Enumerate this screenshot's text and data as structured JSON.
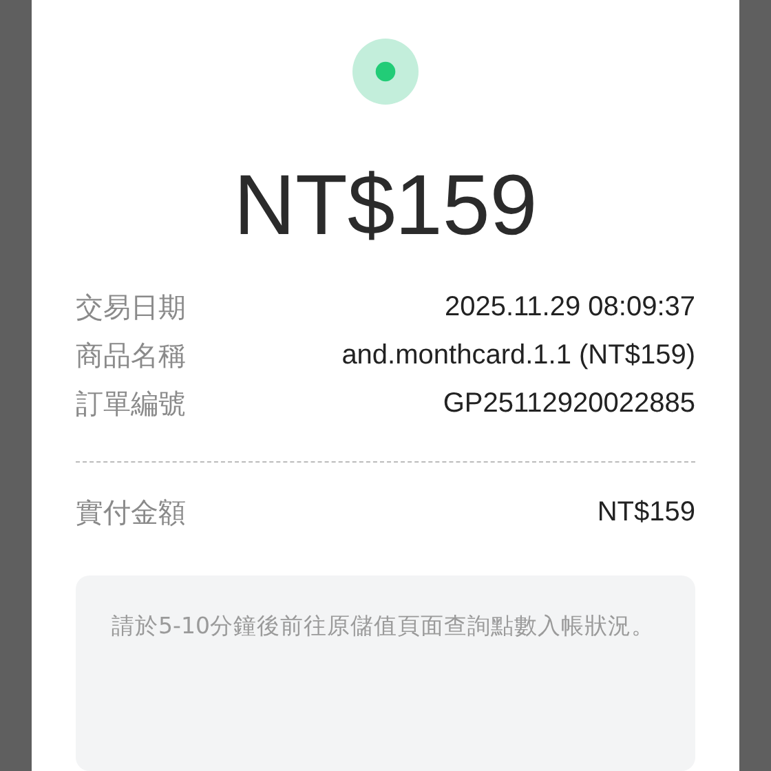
{
  "amount": "NT$159",
  "details": [
    {
      "label": "交易日期",
      "value": "2025.11.29 08:09:37"
    },
    {
      "label": "商品名稱",
      "value": "and.monthcard.1.1 (NT$159)"
    },
    {
      "label": "訂單編號",
      "value": "GP25112920022885"
    }
  ],
  "paid": {
    "label": "實付金額",
    "value": "NT$159"
  },
  "note": "請於5-10分鐘後前往原儲值頁面查詢點數入帳狀況。"
}
